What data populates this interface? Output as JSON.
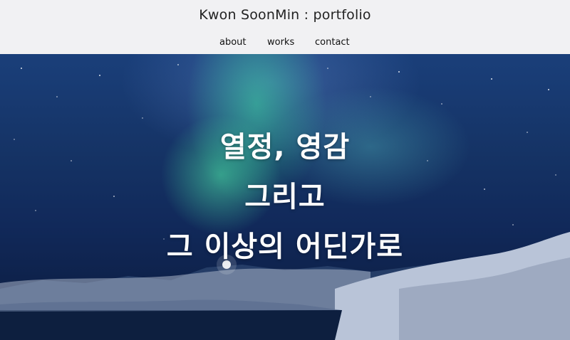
{
  "header": {
    "site_title": "Kwon SoonMin : portfolio",
    "nav": [
      {
        "label": "about"
      },
      {
        "label": "works"
      },
      {
        "label": "contact"
      }
    ]
  },
  "hero": {
    "lines": [
      "열정, 영감",
      "그리고",
      "그 이상의 어딘가로"
    ],
    "background": "northern-lights-landscape"
  },
  "colors": {
    "header_bg": "#f1f1f3",
    "hero_text": "#ffffff",
    "sky": "#153365",
    "aurora": "#3cdca0"
  }
}
